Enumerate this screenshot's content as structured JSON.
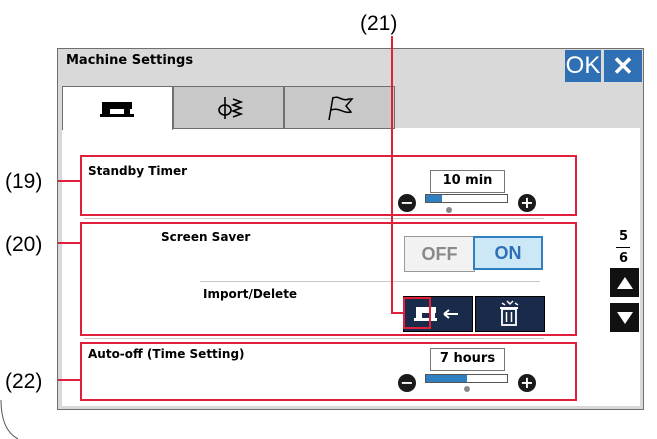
{
  "callouts": {
    "c21": "(21)",
    "c19": "(19)",
    "c20": "(20)",
    "c22": "(22)"
  },
  "window": {
    "title": "Machine Settings",
    "ok_label": "OK",
    "close_glyph": "✕"
  },
  "tabs": [
    {
      "icon": "sewing-machine-icon"
    },
    {
      "icon": "needle-stitch-icon"
    },
    {
      "icon": "flag-icon"
    }
  ],
  "standby": {
    "label": "Standby Timer",
    "value": "10 min",
    "level": 0.2
  },
  "screensaver": {
    "label": "Screen Saver",
    "off_label": "OFF",
    "on_label": "ON",
    "selected": "ON"
  },
  "import_delete": {
    "label": "Import/Delete",
    "import_icon": "import-arrow-icon",
    "delete_icon": "trash-icon"
  },
  "autooff": {
    "label": "Auto-off (Time Setting)",
    "value": "7 hours",
    "level": 0.5
  },
  "pager": {
    "current": "5",
    "total": "6"
  },
  "colors": {
    "accent": "#2f6fb4",
    "highlight": "#e0203a",
    "selected_bg": "#cce8f6"
  }
}
